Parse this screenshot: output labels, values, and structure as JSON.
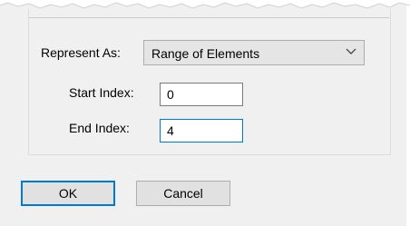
{
  "form": {
    "represent_as_label": "Represent As:",
    "represent_as_value": "Range of Elements",
    "start_index_label": "Start Index:",
    "start_index_value": "0",
    "end_index_label": "End Index:",
    "end_index_value": "4"
  },
  "buttons": {
    "ok_label": "OK",
    "cancel_label": "Cancel"
  },
  "icons": {
    "dropdown": "chevron-down-icon"
  },
  "colors": {
    "dialog_background": "#f0f0f0",
    "focus_accent": "#0078d7",
    "button_face": "#e1e1e1"
  }
}
